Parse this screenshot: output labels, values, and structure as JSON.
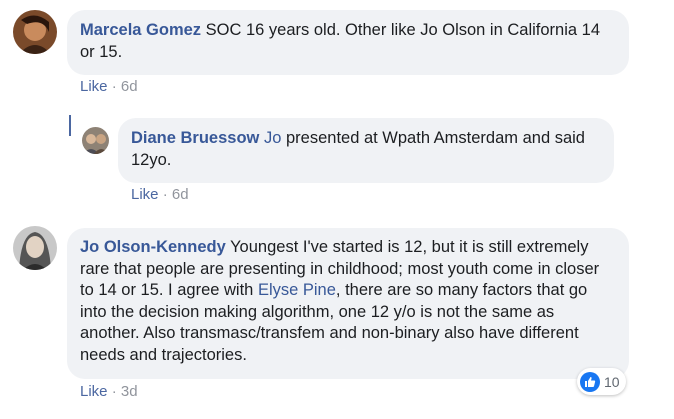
{
  "comments": [
    {
      "author": "Marcela Gomez",
      "text": " SOC 16 years old. Other like Jo Olson in California 14 or 15.",
      "actions": {
        "like": "Like",
        "separator": "·",
        "time": "6d"
      }
    },
    {
      "author": "Diane Bruessow",
      "mention": "Jo",
      "text": " presented at Wpath Amsterdam and said 12yo.",
      "actions": {
        "like": "Like",
        "separator": "·",
        "time": "6d"
      }
    },
    {
      "author": "Jo Olson-Kennedy",
      "text_before": " Youngest I've started is 12, but it is still extremely rare that people are presenting in childhood; most youth come in closer to 14 or 15. I agree with ",
      "mention": "Elyse Pine",
      "text_after": ", there are so many factors that go into the decision making algorithm, one 12 y/o is not the same as another. Also transmasc/transfem and non-binary also have different needs and trajectories.",
      "actions": {
        "like": "Like",
        "separator": "·",
        "time": "3d"
      },
      "reactions": {
        "icon": "thumbs-up-icon",
        "count": "10"
      }
    }
  ],
  "colors": {
    "link": "#385898",
    "bubble": "#f0f2f5",
    "reaction": "#1877f2"
  }
}
